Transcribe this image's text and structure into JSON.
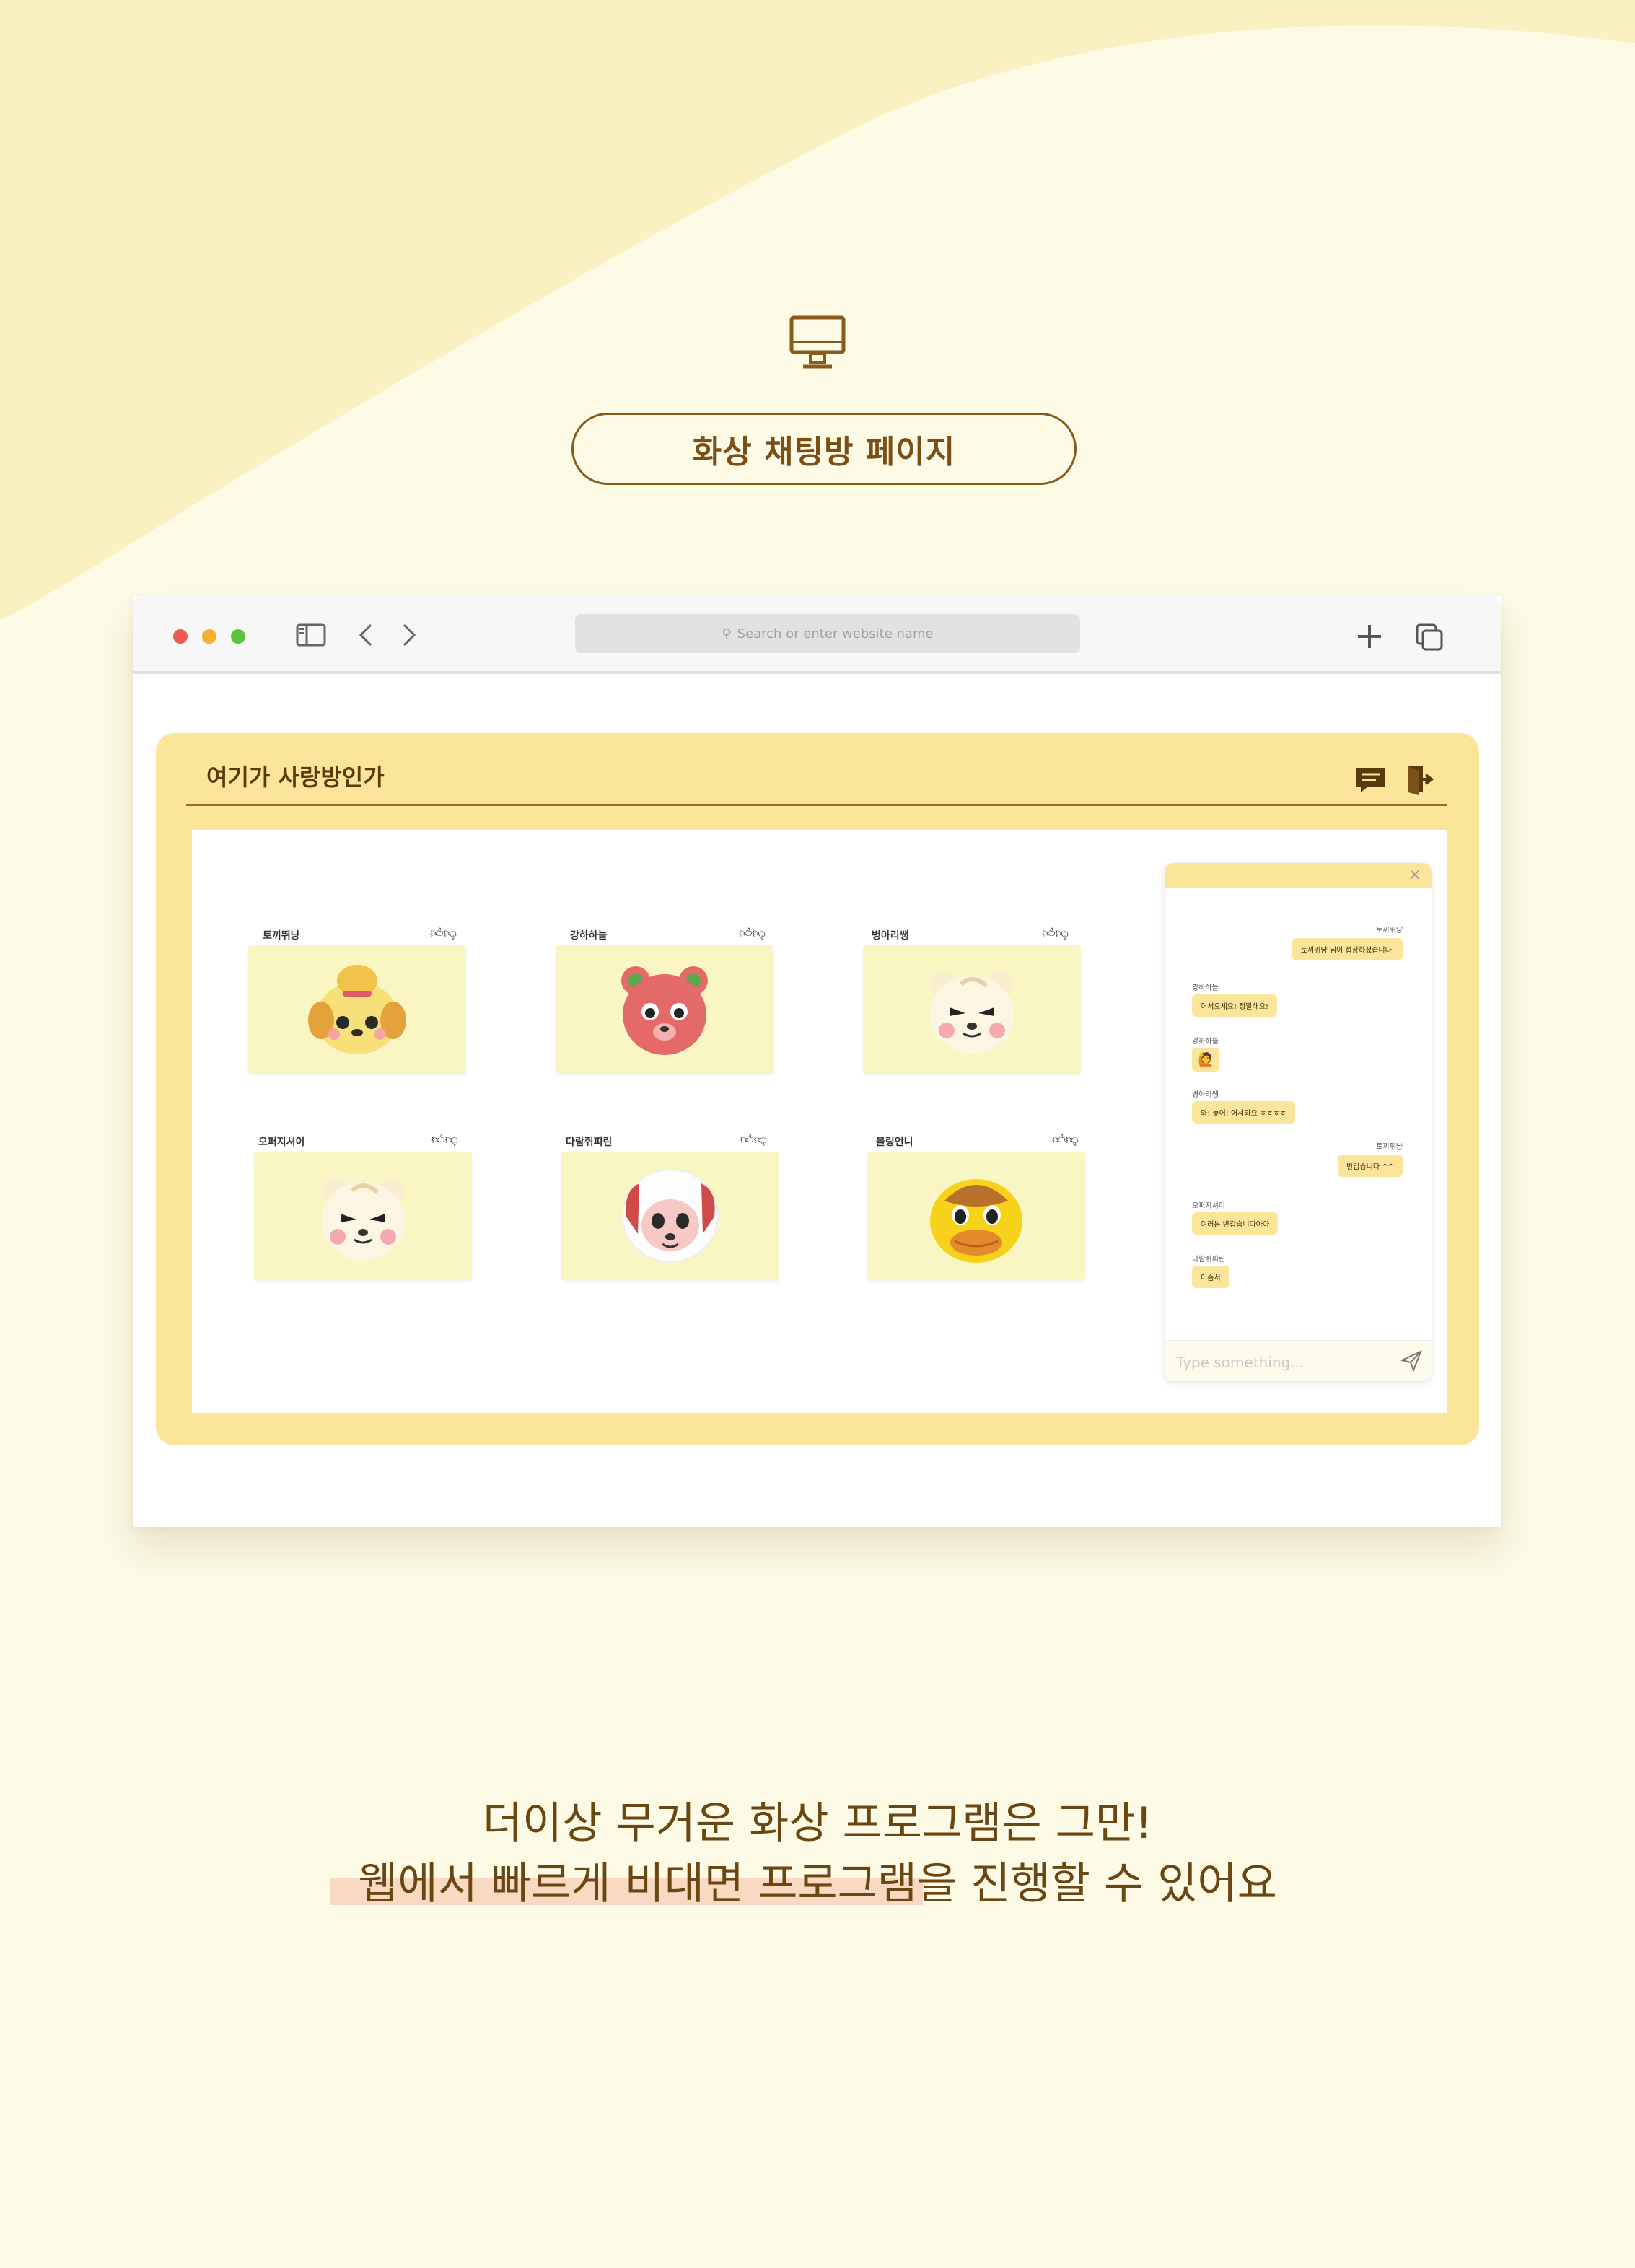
{
  "page": {
    "section_label": "화상 채팅방 페이지",
    "caption_line1": "더이상 무거운 화상 프로그램은 그만!",
    "caption_line2": "웹에서 빠르게 비대면 프로그램을 진행할 수 있어요",
    "colors": {
      "background": "#fdfae6",
      "accent": "#fbe59a",
      "brown": "#7a4e14",
      "highlight": "#f9d9c1"
    }
  },
  "browser": {
    "url_placeholder": "Search or enter website name",
    "traffic_lights": [
      "#ee5a52",
      "#f5b12e",
      "#5cc43d"
    ],
    "icons": [
      "sidebar-icon",
      "back-icon",
      "forward-icon",
      "new-tab-icon",
      "tabs-overview-icon"
    ]
  },
  "room": {
    "title": "여기가 사랑방인가",
    "header_icons": [
      "chat-icon",
      "exit-icon"
    ],
    "participants": [
      {
        "name": "토끼뛰냥",
        "likes": "👍︎👎︎",
        "avatar": "dog-avatar"
      },
      {
        "name": "강하하늘",
        "likes": "👍︎👎︎",
        "avatar": "bear-avatar"
      },
      {
        "name": "병아리쌩",
        "likes": "👍︎👎︎",
        "avatar": "cub-avatar"
      },
      {
        "name": "오퍼지셔이",
        "likes": "👍︎👎︎",
        "avatar": "cub-avatar"
      },
      {
        "name": "다람쥐피린",
        "likes": "👍︎👎︎",
        "avatar": "sheep-avatar"
      },
      {
        "name": "블링언니",
        "likes": "👍︎👎︎",
        "avatar": "duck-avatar"
      }
    ]
  },
  "chat": {
    "close": "×",
    "messages": [
      {
        "name": "토끼뛰냥",
        "text": "토끼뛰냥 님이 접장하셨습니다.",
        "side": "right"
      },
      {
        "name": "강하하늘",
        "text": "어서오세요! 정말해요!",
        "side": "left"
      },
      {
        "name": "강하하늘",
        "text": "🙋",
        "side": "left"
      },
      {
        "name": "병아리쌩",
        "text": "와! 늦어! 어서와요 ㅎㅎㅎㅎ",
        "side": "left"
      },
      {
        "name": "토끼뛰냥",
        "text": "반갑습니다 ^^",
        "side": "right"
      },
      {
        "name": "오퍼지셔이",
        "text": "여러분 반갑습니다아아",
        "side": "left"
      },
      {
        "name": "다람쥐피린",
        "text": "어솜서",
        "side": "left"
      }
    ],
    "input_placeholder": "Type something..."
  }
}
